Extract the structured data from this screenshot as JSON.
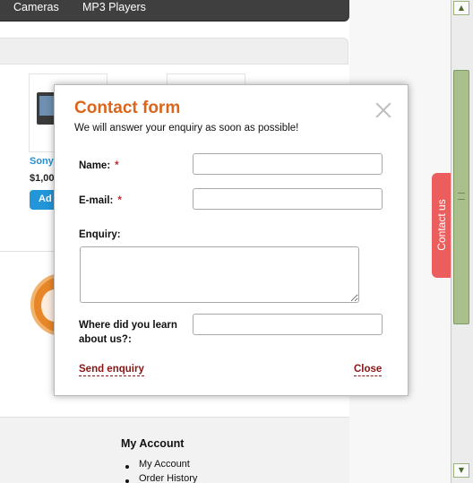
{
  "nav": {
    "items": [
      "Cameras",
      "MP3 Players"
    ]
  },
  "product": {
    "name": "Sony",
    "price": "$1,00",
    "add_button": "Ad"
  },
  "footer": {
    "title": "My Account",
    "links": [
      "My Account",
      "Order History"
    ]
  },
  "contact_tab": {
    "label": "Contact us"
  },
  "modal": {
    "title": "Contact form",
    "subtitle": "We will answer your enquiry as soon as possible!",
    "fields": {
      "name": {
        "label": "Name:",
        "required_mark": "*",
        "value": ""
      },
      "email": {
        "label": "E-mail:",
        "required_mark": "*",
        "value": ""
      },
      "enquiry": {
        "label": "Enquiry:",
        "value": ""
      },
      "source": {
        "label": "Where did you learn about us?:",
        "value": ""
      }
    },
    "send_link": "Send enquiry",
    "close_link": "Close"
  },
  "colors": {
    "title_orange": "#d9661b",
    "link_red": "#8a1515",
    "contact_tab": "#ec5e5e",
    "nav_bg": "#3f3f3f",
    "add_button": "#2296d9"
  },
  "icons": {
    "close": "close-icon",
    "scroll_up": "arrow-up-icon",
    "scroll_down": "arrow-down-icon"
  }
}
